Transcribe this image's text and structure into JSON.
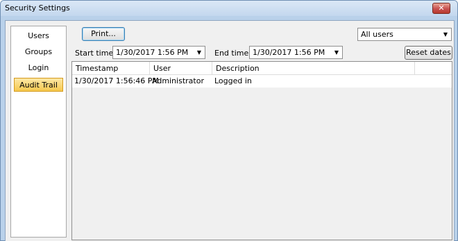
{
  "window": {
    "title": "Security Settings",
    "close_glyph": "✕",
    "close_icon": "close-icon"
  },
  "nav": {
    "items": [
      {
        "label": "Users",
        "active": false
      },
      {
        "label": "Groups",
        "active": false
      },
      {
        "label": "Login",
        "active": false
      },
      {
        "label": "Audit Trail",
        "active": true
      }
    ]
  },
  "toolbar": {
    "print_label": "Print...",
    "user_filter": {
      "selected": "All users"
    },
    "start_time_label": "Start time:",
    "start_time_value": "1/30/2017 1:56 PM",
    "end_time_label": "End time:",
    "end_time_value": "1/30/2017 1:56 PM",
    "reset_label": "Reset dates",
    "dropdown_icon": "chevron-down-icon",
    "dropdown_glyph": "▼"
  },
  "table": {
    "columns": [
      "Timestamp",
      "User",
      "Description"
    ],
    "rows": [
      [
        "1/30/2017 1:56:46 PM",
        "Administrator",
        "Logged in"
      ]
    ]
  },
  "colors": {
    "window_frame": "#b9d1ea",
    "active_nav": "#f6c84d",
    "close_button": "#c75050"
  }
}
